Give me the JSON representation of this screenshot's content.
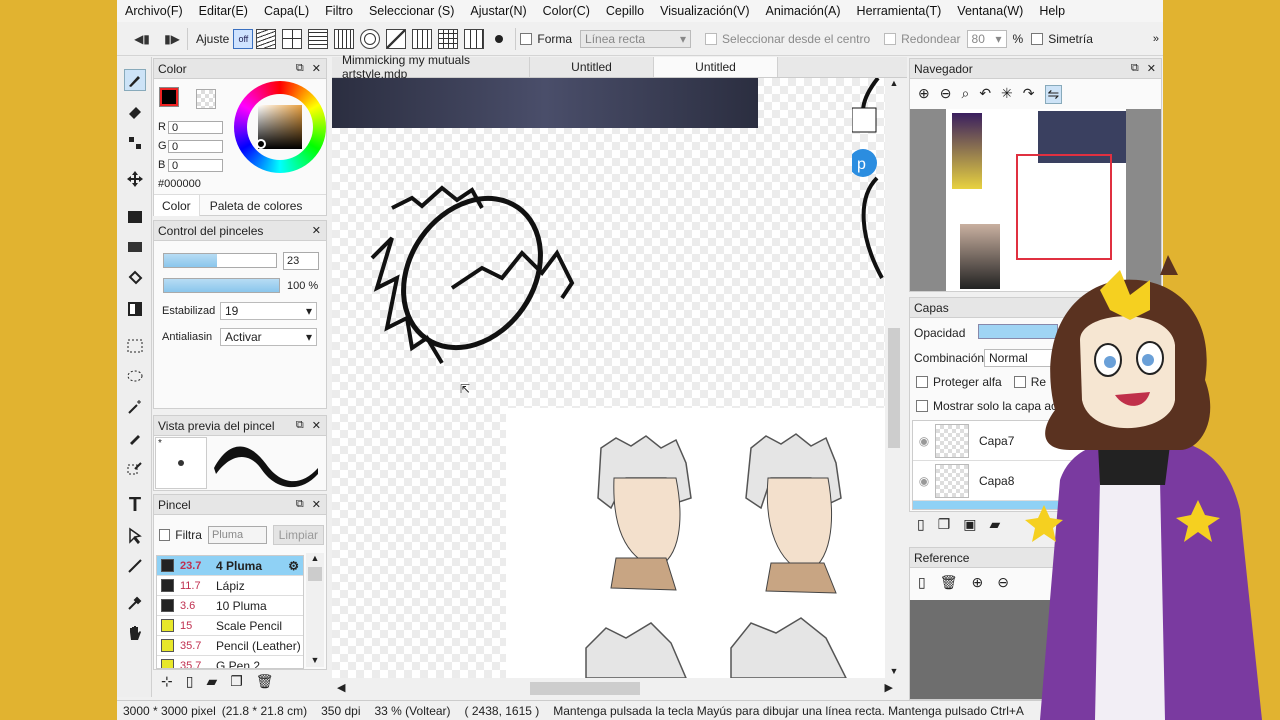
{
  "menu": [
    "Archivo(F)",
    "Editar(E)",
    "Capa(L)",
    "Filtro",
    "Seleccionar (S)",
    "Ajustar(N)",
    "Color(C)",
    "Cepillo",
    "Visualización(V)",
    "Animación(A)",
    "Herramienta(T)",
    "Ventana(W)",
    "Help"
  ],
  "toolbar": {
    "ajuste_label": "Ajuste",
    "off_label": "off",
    "forma_label": "Forma",
    "forma_value": "Línea recta",
    "select_center_label": "Seleccionar desde el centro",
    "redondear_label": "Redondear",
    "redondear_value": "80",
    "percent_sign": "%",
    "simetria_label": "Simetría"
  },
  "color_panel": {
    "title": "Color",
    "r_label": "R",
    "r_value": "0",
    "g_label": "G",
    "g_value": "0",
    "b_label": "B",
    "b_value": "0",
    "hex": "#000000",
    "tab_color": "Color",
    "tab_palette": "Paleta de colores",
    "fg_color": "#000000",
    "bg_color": "#f5c518"
  },
  "brush_control": {
    "title": "Control del pinceles",
    "size_value": "23",
    "opacity_value": "100 %",
    "size_fraction": 0.47,
    "opacity_fraction": 1.0,
    "estabilidad_label": "Estabilizad",
    "estabilidad_value": "19",
    "antialias_label": "Antialiasin",
    "antialias_value": "Activar"
  },
  "brush_preview": {
    "title": "Vista previa del pincel",
    "star": "*"
  },
  "brush_list": {
    "title": "Pincel",
    "filter_label": "Filtra",
    "filter_placeholder": "Pluma",
    "clear_label": "Limpiar",
    "items": [
      {
        "size": "23.7",
        "name": "4 Pluma",
        "swatch": "#222222"
      },
      {
        "size": "11.7",
        "name": "Lápiz",
        "swatch": "#222222"
      },
      {
        "size": "3.6",
        "name": "10 Pluma",
        "swatch": "#222222"
      },
      {
        "size": "15",
        "name": "Scale Pencil",
        "swatch": "#e8e82a"
      },
      {
        "size": "35.7",
        "name": "Pencil (Leather)",
        "swatch": "#e8e82a"
      },
      {
        "size": "35.7",
        "name": "G Pen 2",
        "swatch": "#e8e82a"
      }
    ]
  },
  "tabs": [
    "Mimmicking my mutuals artstyle.mdp",
    "Untitled",
    "Untitled"
  ],
  "navigator": {
    "title": "Navegador"
  },
  "layers": {
    "title": "Capas",
    "opacity_label": "Opacidad",
    "blend_label": "Combinación",
    "blend_value": "Normal",
    "protect_alpha": "Proteger alfa",
    "ref_label": "Re",
    "show_only": "Mostrar solo la capa activ",
    "items": [
      "Capa7",
      "Capa8"
    ]
  },
  "reference": {
    "title": "Reference"
  },
  "status": {
    "size": "3000 * 3000 pixel",
    "cm": "(21.8 * 21.8 cm)",
    "dpi": "350 dpi",
    "zoom": "33 % (Voltear)",
    "coords": "( 2438, 1615 )",
    "hint": "Mantenga pulsada la tecla Mayús para dibujar una línea recta. Mantenga pulsado Ctrl+A"
  },
  "colors": {
    "selection": "#8fd1f5",
    "accent_purple": "#7a3aa0",
    "window_bg": "#e1b330"
  }
}
